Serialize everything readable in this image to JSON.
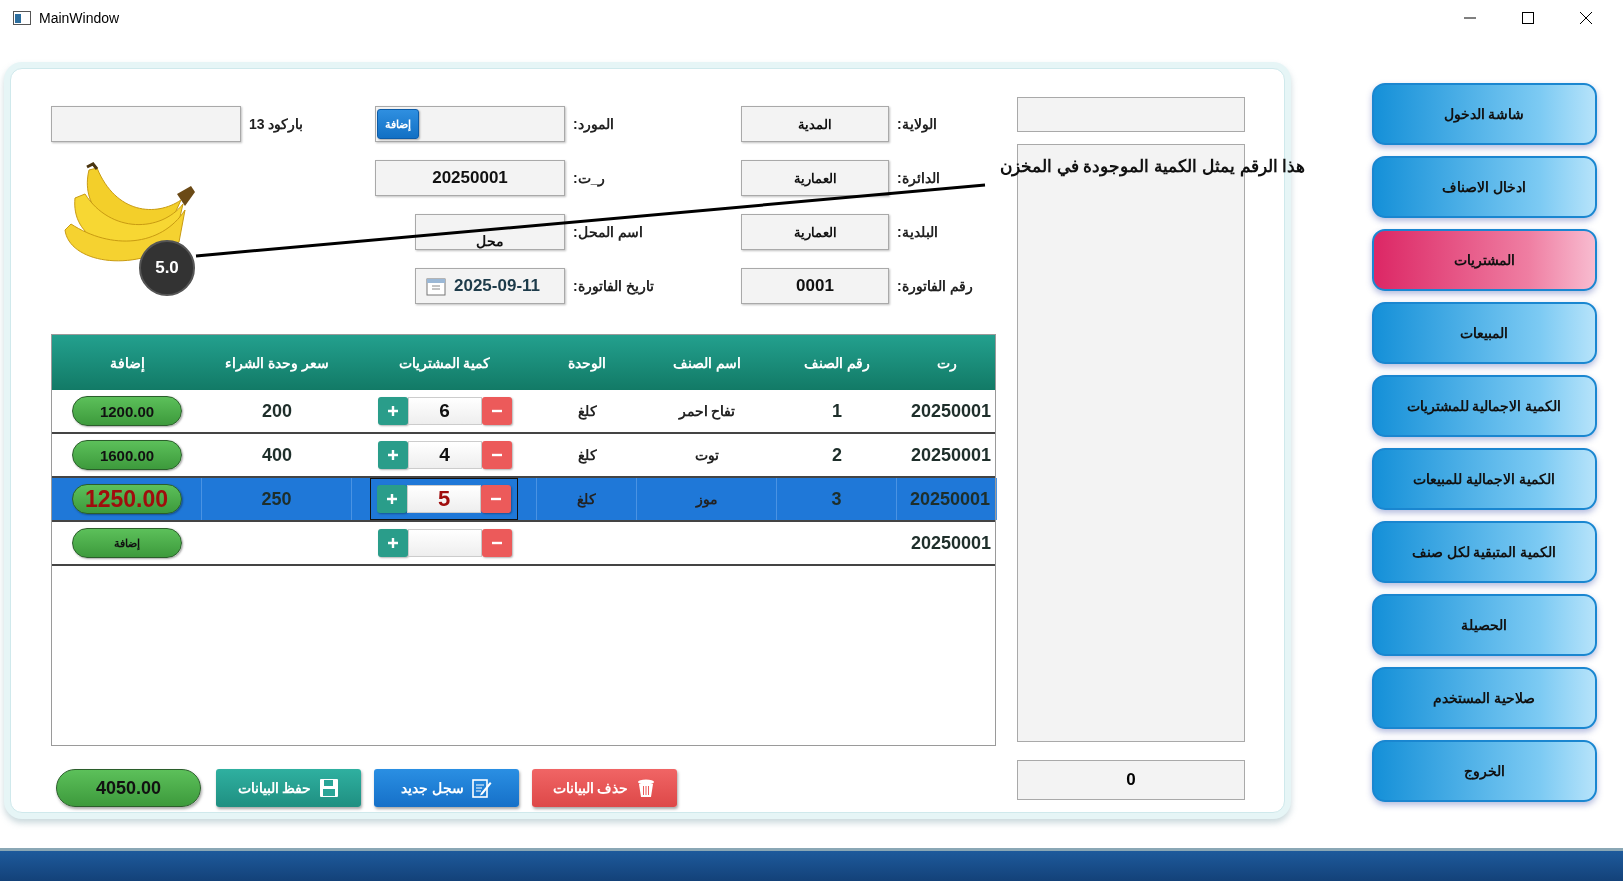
{
  "window": {
    "title": "MainWindow"
  },
  "form": {
    "barcode_label": "باركود 13",
    "supplier": {
      "label": "المورد:",
      "button": "إضافة"
    },
    "serial": {
      "label": "ر_ت:",
      "value": "20250001"
    },
    "shop": {
      "label": "اسم المحل:",
      "value": "محل"
    },
    "date": {
      "label": "تاريخ الفاتورة:",
      "value": "2025-09-11"
    },
    "wilaya": {
      "label": "الولاية:",
      "value": "المدية"
    },
    "daira": {
      "label": "الدائرة:",
      "value": "العمارية"
    },
    "baladia": {
      "label": "البلدية:",
      "value": "العمارية"
    },
    "invoice": {
      "label": "رقم الفاتورة:",
      "value": "0001"
    }
  },
  "product": {
    "stock_badge": "5.0",
    "annotation": "هذا الرقم يمثل الكمية الموجودة في المخزن"
  },
  "table": {
    "columns": [
      "رت",
      "رقم الصنف",
      "اسم الصنف",
      "الوحدة",
      "كمية المشتريات",
      "سعر وحدة الشراء",
      "إضافة"
    ],
    "rows": [
      {
        "kind": "item",
        "rt": "20250001",
        "code": "1",
        "name": "تفاح احمر",
        "unit": "كلغ",
        "qty": "6",
        "price": "200",
        "total": "1200.00",
        "selected": false
      },
      {
        "kind": "item",
        "rt": "20250001",
        "code": "2",
        "name": "توت",
        "unit": "كلغ",
        "qty": "4",
        "price": "400",
        "total": "1600.00",
        "selected": false
      },
      {
        "kind": "item",
        "rt": "20250001",
        "code": "3",
        "name": "موز",
        "unit": "كلغ",
        "qty": "5",
        "price": "250",
        "total": "1250.00",
        "selected": true
      },
      {
        "kind": "new",
        "rt": "20250001",
        "action": "إضافة",
        "selected": false
      }
    ]
  },
  "footer": {
    "total": "4050.00",
    "buttons": [
      {
        "kind": "delete",
        "label": "حذف البيانات"
      },
      {
        "kind": "new",
        "label": "سجل جديد"
      },
      {
        "kind": "save",
        "label": "حفظ البيانات"
      }
    ],
    "side_total": "0"
  },
  "nav": [
    {
      "label": "شاشة الدخول",
      "selected": false
    },
    {
      "label": "ادخال الاصناف",
      "selected": false
    },
    {
      "label": "المشتريات",
      "selected": true
    },
    {
      "label": "المبيعات",
      "selected": false
    },
    {
      "label": "الكمية الاجمالية للمشتريات",
      "selected": false
    },
    {
      "label": "الكمية الاجمالية للمبيعات",
      "selected": false
    },
    {
      "label": "الكمية المتبقية لكل صنف",
      "selected": false
    },
    {
      "label": "الحصيلة",
      "selected": false
    },
    {
      "label": "صلاحية المستخدم",
      "selected": false
    },
    {
      "label": "الخروج",
      "selected": false
    }
  ]
}
